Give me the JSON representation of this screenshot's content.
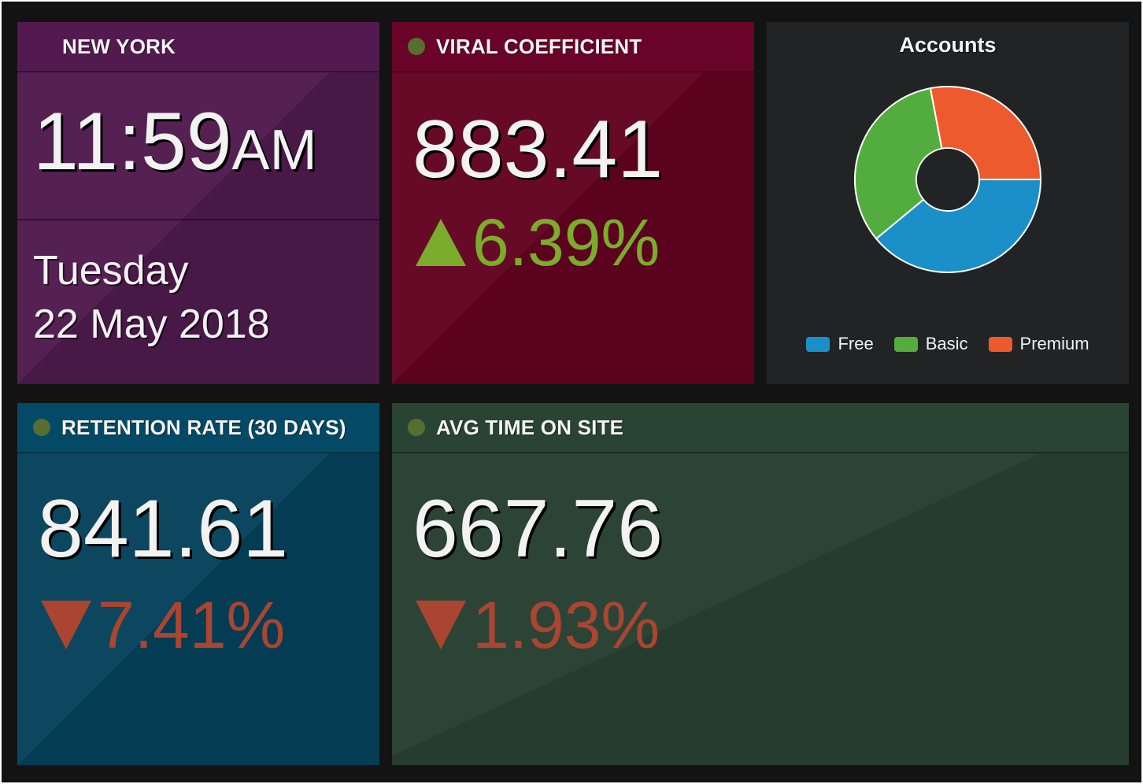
{
  "clock": {
    "city": "NEW YORK",
    "time": "11:59",
    "meridiem": "AM",
    "weekday": "Tuesday",
    "date": "22 May 2018"
  },
  "viral": {
    "title": "VIRAL COEFFICIENT",
    "value": "883.41",
    "change": "6.39%",
    "direction": "up"
  },
  "retention": {
    "title": "RETENTION RATE (30 DAYS)",
    "value": "841.61",
    "change": "7.41%",
    "direction": "down"
  },
  "avg_time": {
    "title": "AVG TIME ON SITE",
    "value": "667.76",
    "change": "1.93%",
    "direction": "down"
  },
  "accounts": {
    "title": "Accounts"
  },
  "colors": {
    "frame": "#131313",
    "clock_tile": "#4e1a4c",
    "viral_tile": "#620221",
    "accounts_tile": "#222324",
    "retention_tile": "#04415a",
    "avg_time_tile": "#274031",
    "status_dot": "#566f31",
    "positive": "#7bac2b",
    "negative": "#a94531"
  },
  "chart_data": {
    "type": "pie",
    "title": "Accounts",
    "donut": true,
    "labels": [
      "Free",
      "Basic",
      "Premium"
    ],
    "values": [
      39,
      33,
      28
    ],
    "colors": [
      "#1b8fc8",
      "#52ad3e",
      "#ed5a2e"
    ],
    "legend": "bottom"
  }
}
